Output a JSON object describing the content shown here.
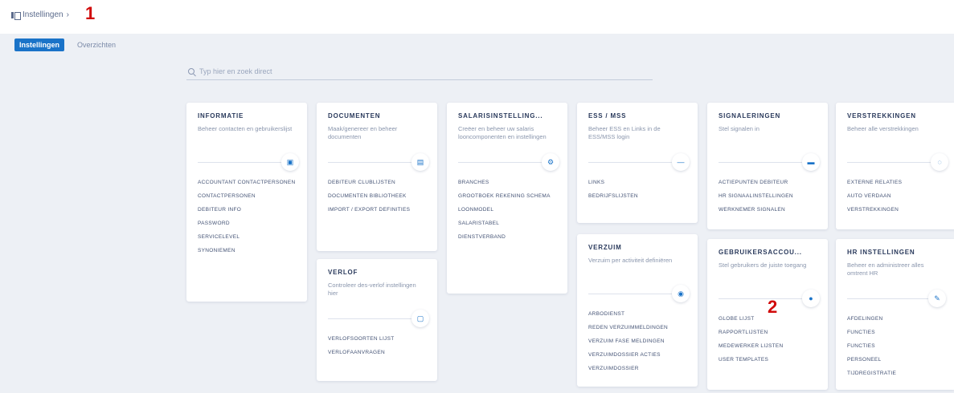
{
  "header": {
    "breadcrumb": "Instellingen",
    "breadcrumb_chevron": "›"
  },
  "annotations": {
    "first": "1",
    "second": "2"
  },
  "tabs": [
    {
      "label": "Instellingen",
      "active": true
    },
    {
      "label": "Overzichten",
      "active": false
    }
  ],
  "search": {
    "placeholder": "Typ hier en zoek direct"
  },
  "cards": [
    {
      "title": "INFORMATIE",
      "desc": "Beheer contacten en gebruikerslijst",
      "icon": "id-card-icon",
      "glyph": "▣",
      "items": [
        "ACCOUNTANT CONTACTPERSONEN",
        "CONTACTPERSONEN",
        "DEBITEUR INFO",
        "PASSWORD",
        "SERVICELEVEL",
        "SYNONIEMEN"
      ]
    },
    {
      "title": "DOCUMENTEN",
      "desc": "Maak/genereer en beheer documenten",
      "icon": "document-icon",
      "glyph": "▤",
      "items": [
        "DEBITEUR CLUBLIJSTEN",
        "DOCUMENTEN BIBLIOTHEEK",
        "IMPORT / EXPORT DEFINITIES"
      ]
    },
    {
      "title": "VERLOF",
      "desc": "Controleer des-verlof instellingen hier",
      "icon": "calendar-icon",
      "glyph": "▢",
      "items": [
        "VERLOFSOORTEN LIJST",
        "VERLOFAANVRAGEN"
      ]
    },
    {
      "title": "SALARISINSTELLING...",
      "desc": "Creëer en beheer uw salaris looncomponenten en instellingen",
      "icon": "gear-icon",
      "glyph": "⚙",
      "items": [
        "BRANCHES",
        "GROOTBOEK REKENING SCHEMA",
        "LOONMODEL",
        "SALARISTABEL",
        "DIENSTVERBAND"
      ]
    },
    {
      "title": "ESS / MSS",
      "desc": "Beheer ESS en Links in de ESS/MSS login",
      "icon": "minus-icon",
      "glyph": "—",
      "items": [
        "LINKS",
        "BEDRIJFSLIJSTEN"
      ]
    },
    {
      "title": "VERZUIM",
      "desc": "Verzuim per activiteit definiëren",
      "icon": "eye-icon",
      "glyph": "◉",
      "items": [
        "ARBODIENST",
        "REDEN VERZUIMMELDINGEN",
        "VERZUIM FASE MELDINGEN",
        "VERZUIMDOSSIER ACTIES",
        "VERZUIMDOSSIER"
      ]
    },
    {
      "title": "SIGNALERINGEN",
      "desc": "Stel signalen in",
      "icon": "car-icon",
      "glyph": "▬",
      "items": [
        "ACTIEPUNTEN DEBITEUR",
        "HR SIGNAALINSTELLINGEN",
        "WERKNEMER SIGNALEN"
      ]
    },
    {
      "title": "GEBRUIKERSACCOU...",
      "desc": "Stel gebruikers de juiste toegang",
      "icon": "user-icon",
      "glyph": "●",
      "items": [
        "GLOBE LIJST",
        "RAPPORTLIJSTEN",
        "MEDEWERKER LIJSTEN",
        "USER TEMPLATES"
      ]
    },
    {
      "title": "VERSTREKKINGEN",
      "desc": "Beheer alle verstrekkingen",
      "icon": "lightbulb-icon",
      "glyph": "◌",
      "items": [
        "EXTERNE RELATIES",
        "AUTO VERDAAN",
        "VERSTREKKINGEN"
      ]
    },
    {
      "title": "HR INSTELLINGEN",
      "desc": "Beheer en administreer alles omtrent HR",
      "icon": "wrench-icon",
      "glyph": "✎",
      "items": [
        "AFDELINGEN",
        "FUNCTIES",
        "FUNCTIES",
        "PERSONEEL",
        "TIJDREGISTRATIE"
      ]
    }
  ]
}
